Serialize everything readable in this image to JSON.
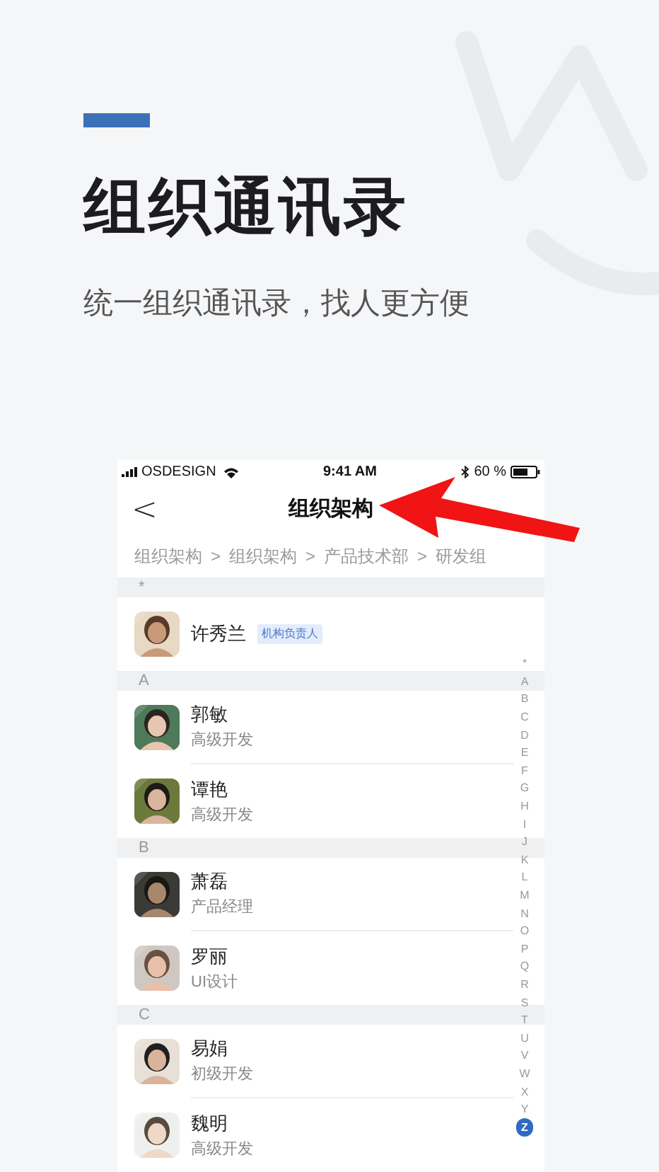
{
  "headline": {
    "title": "组织通讯录",
    "subtitle": "统一组织通讯录，找人更方便"
  },
  "status_bar": {
    "carrier": "OSDESIGN",
    "time": "9:41 AM",
    "battery": "60 %"
  },
  "nav": {
    "back": "<",
    "title": "组织架构"
  },
  "breadcrumb": [
    "组织架构",
    "组织架构",
    "产品技术部",
    "研发组"
  ],
  "breadcrumb_separator": ">",
  "sections": [
    {
      "letter": "*",
      "members": [
        {
          "name": "许秀兰",
          "badge": "机构负责人"
        }
      ]
    },
    {
      "letter": "A",
      "members": [
        {
          "name": "郭敏",
          "role": "高级开发"
        },
        {
          "name": "谭艳",
          "role": "高级开发"
        }
      ]
    },
    {
      "letter": "B",
      "members": [
        {
          "name": "萧磊",
          "role": "产品经理"
        },
        {
          "name": "罗丽",
          "role": "UI设计"
        }
      ]
    },
    {
      "letter": "C",
      "members": [
        {
          "name": "易娟",
          "role": "初级开发"
        },
        {
          "name": "魏明",
          "role": "高级开发"
        }
      ]
    }
  ],
  "index": [
    {
      "label": "*",
      "selected": false
    },
    {
      "label": "A",
      "selected": false
    },
    {
      "label": "B",
      "selected": false
    },
    {
      "label": "C",
      "selected": false
    },
    {
      "label": "D",
      "selected": false
    },
    {
      "label": "E",
      "selected": false
    },
    {
      "label": "F",
      "selected": false
    },
    {
      "label": "G",
      "selected": false
    },
    {
      "label": "H",
      "selected": false
    },
    {
      "label": "I",
      "selected": false
    },
    {
      "label": "J",
      "selected": false
    },
    {
      "label": "K",
      "selected": false
    },
    {
      "label": "L",
      "selected": false
    },
    {
      "label": "M",
      "selected": false
    },
    {
      "label": "N",
      "selected": false
    },
    {
      "label": "O",
      "selected": false
    },
    {
      "label": "P",
      "selected": false
    },
    {
      "label": "Q",
      "selected": false
    },
    {
      "label": "R",
      "selected": false
    },
    {
      "label": "S",
      "selected": false
    },
    {
      "label": "T",
      "selected": false
    },
    {
      "label": "U",
      "selected": false
    },
    {
      "label": "V",
      "selected": false
    },
    {
      "label": "W",
      "selected": false
    },
    {
      "label": "X",
      "selected": false
    },
    {
      "label": "Y",
      "selected": false
    },
    {
      "label": "Z",
      "selected": true
    }
  ]
}
